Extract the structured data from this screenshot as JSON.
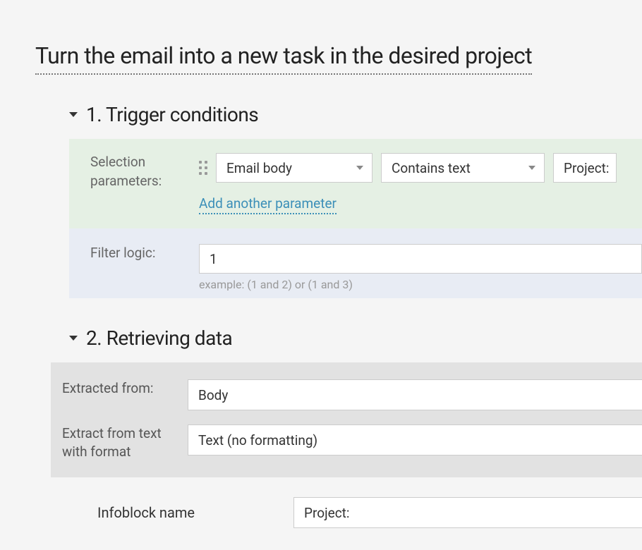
{
  "title": "Turn the email into a new task in the desired project",
  "section1": {
    "title": "1. Trigger conditions",
    "selection_label": "Selection parameters:",
    "field_select": "Email body",
    "operator_select": "Contains text",
    "value_select": "Project:",
    "add_link": "Add another parameter",
    "filter_label": "Filter logic:",
    "filter_value": "1",
    "filter_hint": "example: (1 and 2) or (1 and 3)"
  },
  "section2": {
    "title": "2. Retrieving data",
    "extracted_label": "Extracted from:",
    "extracted_value": "Body",
    "format_label": "Extract from text with format",
    "format_value": "Text (no formatting)",
    "infoblock_label": "Infoblock name",
    "infoblock_value": "Project:"
  }
}
